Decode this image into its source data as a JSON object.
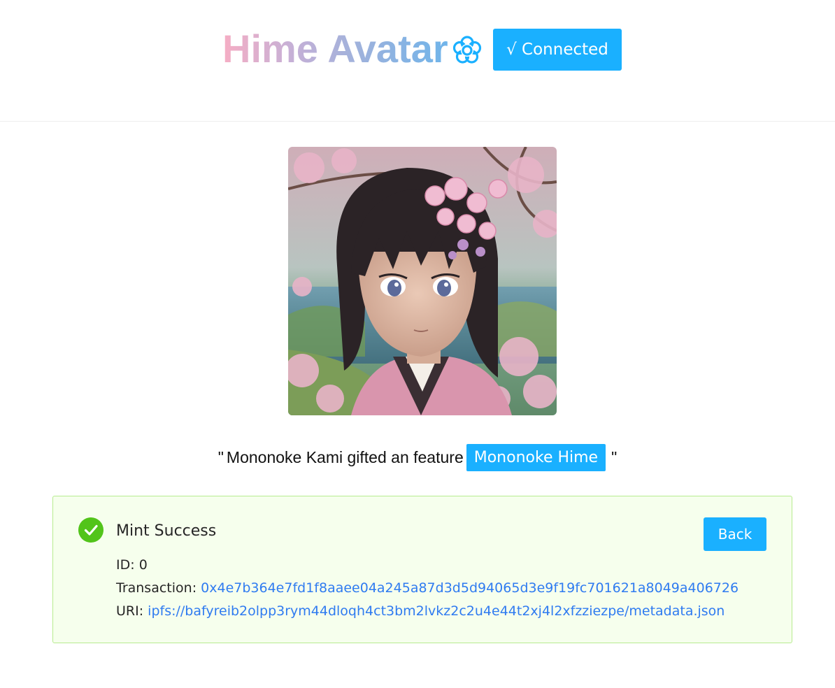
{
  "header": {
    "title": "Hime Avatar",
    "title_icon": "flower-icon",
    "connected_label": "√ Connected"
  },
  "avatar": {
    "image": "anime-girl-cherry-blossom"
  },
  "quote": {
    "open": "\"",
    "text": "Mononoke Kami gifted an feature",
    "feature": "Mononoke Hime",
    "close": "\""
  },
  "result": {
    "status": "success",
    "icon": "check-circle-icon",
    "title": "Mint Success",
    "back_label": "Back",
    "id_label": "ID:",
    "id_value": "0",
    "tx_label": "Transaction:",
    "tx_value": "0x4e7b364e7fd1f8aaee04a245a87d3d5d94065d3e9f19fc701621a8049a406726",
    "uri_label": "URI:",
    "uri_value": "ipfs://bafyreib2olpp3rym44dloqh4ct3bm2lvkz2c2u4e44t2xj4l2xfzziezpe/metadata.json"
  },
  "colors": {
    "accent": "#1ab0ff",
    "success": "#52c41a",
    "success_bg": "#f6ffed",
    "success_border": "#b7eb8f",
    "link": "#2f7bf0"
  }
}
